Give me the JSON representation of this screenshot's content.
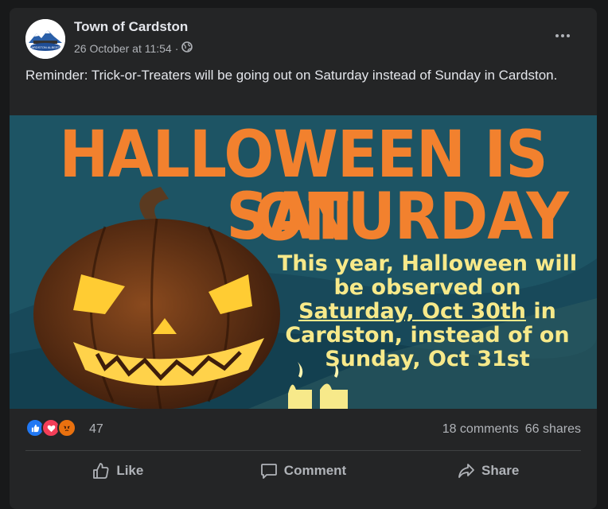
{
  "post": {
    "page_name": "Town of Cardston",
    "timestamp": "26 October at 11:54",
    "separator": "·",
    "privacy_icon": "globe-icon",
    "avatar_text": "CARDSTON ALBERTA",
    "text": "Reminder: Trick-or-Treaters will be going out on Saturday instead of Sunday in Cardston."
  },
  "image": {
    "headline_line1": "HALLOWEEN IS ON",
    "headline_line2": "SATURDAY",
    "body_line1": "This year, Halloween will",
    "body_line2": "be observed on",
    "body_underlined": "Saturday, Oct 30th",
    "body_line3_suffix": " in",
    "body_line4": "Cardston, instead of on",
    "body_line5": "Sunday, Oct 31st"
  },
  "engagement": {
    "reaction_icons": [
      "like-icon",
      "love-icon",
      "angry-icon"
    ],
    "reaction_count": "47",
    "comments": "18 comments",
    "shares": "66 shares"
  },
  "actions": {
    "like": "Like",
    "comment": "Comment",
    "share": "Share"
  },
  "colors": {
    "card_bg": "#242526",
    "headline_orange": "#f2812e",
    "body_yellow": "#f7e98a",
    "like_blue": "#2078f4",
    "love_red": "#f33e58",
    "angry_orange": "#e9710f"
  }
}
